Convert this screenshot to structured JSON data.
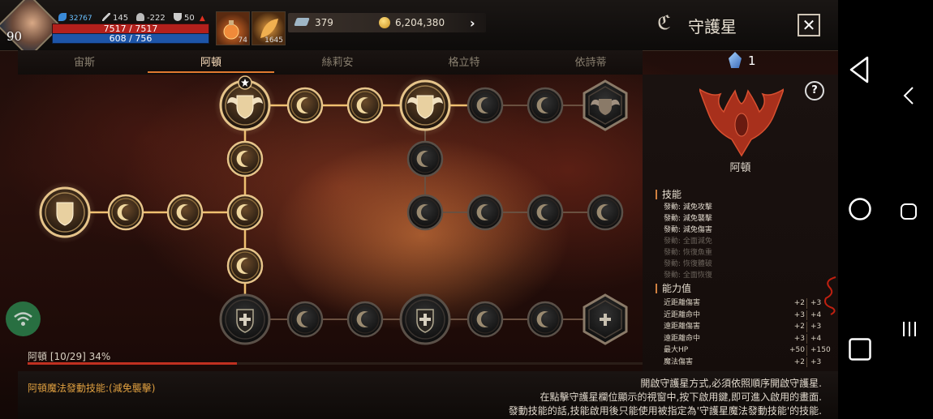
{
  "player": {
    "level": "90",
    "power": "32767",
    "attack": "145",
    "defense": "-222",
    "trophy": "50",
    "hp": "7517 / 7517",
    "mp": "608 / 756"
  },
  "items": {
    "potion_count": "74",
    "leaf_count": "1645"
  },
  "currency": {
    "gems": "379",
    "gold": "6,204,380"
  },
  "title": "守護星",
  "tabs": [
    {
      "label": "宙斯",
      "active": false
    },
    {
      "label": "阿頓",
      "active": true
    },
    {
      "label": "絲莉安",
      "active": false
    },
    {
      "label": "格立特",
      "active": false
    },
    {
      "label": "依詩蒂",
      "active": false
    }
  ],
  "crystal_count": "1",
  "panel": {
    "constellation_name": "阿頓",
    "skills_header": "技能",
    "skills": [
      {
        "name": "發動: 減免攻擊",
        "active": true
      },
      {
        "name": "發動: 減免襲擊",
        "active": true
      },
      {
        "name": "發動: 減免傷害",
        "active": true
      },
      {
        "name": "發動: 全面減免",
        "active": false
      },
      {
        "name": "發動: 恢復魚重",
        "active": false
      },
      {
        "name": "發動: 恢復體破",
        "active": false
      },
      {
        "name": "發動: 全面恢復",
        "active": false
      }
    ],
    "attributes_header": "能力值",
    "attributes": [
      {
        "name": "近距離傷害",
        "current": "+2",
        "next": "+3"
      },
      {
        "name": "近距離命中",
        "current": "+3",
        "next": "+4"
      },
      {
        "name": "遠距離傷害",
        "current": "+2",
        "next": "+3"
      },
      {
        "name": "遠距離命中",
        "current": "+3",
        "next": "+4"
      },
      {
        "name": "最大HP",
        "current": "+50",
        "next": "+150"
      },
      {
        "name": "魔法傷害",
        "current": "+2",
        "next": "+3"
      }
    ]
  },
  "progress": {
    "label": "阿頓 [10/29] 34%",
    "fraction": 0.34
  },
  "magic_skill": "阿頓魔法發動技能:(減免襲擊)",
  "info_lines": [
    "開啟守護星方式,必須依照順序開啟守護星.",
    "在點擊守護星欄位顯示的視窗中,按下啟用鍵,即可進入啟用的畫面.",
    "發動技能的話,技能啟用後只能使用被指定為'守護星魔法發動技能'的技能."
  ],
  "colors": {
    "accent": "#e07a30",
    "hp": "#b3201c",
    "mp": "#1d55a8",
    "gold": "#e0a040"
  },
  "nodes": [
    {
      "id": "start",
      "type": "shield",
      "state": "active",
      "icon": "shield-icon"
    },
    {
      "id": "l1",
      "type": "moon",
      "state": "active",
      "icon": "crescent-icon"
    },
    {
      "id": "l2",
      "type": "moon",
      "state": "active",
      "icon": "crescent-icon"
    },
    {
      "id": "junction",
      "type": "moon",
      "state": "active",
      "icon": "crescent-icon"
    },
    {
      "id": "v-up",
      "type": "moon",
      "state": "active",
      "icon": "crescent-icon"
    },
    {
      "id": "top-boss",
      "type": "winged-shield",
      "state": "active",
      "icon": "winged-shield-icon",
      "star": true
    },
    {
      "id": "t1",
      "type": "moon",
      "state": "active",
      "icon": "crescent-icon"
    },
    {
      "id": "t2",
      "type": "moon",
      "state": "active",
      "icon": "crescent-icon"
    },
    {
      "id": "top-boss-2",
      "type": "winged-shield",
      "state": "active",
      "icon": "winged-shield-icon"
    },
    {
      "id": "t3",
      "type": "moon",
      "state": "locked",
      "icon": "crescent-icon"
    },
    {
      "id": "t4",
      "type": "moon",
      "state": "locked",
      "icon": "crescent-icon"
    },
    {
      "id": "top-end",
      "type": "hex-emblem",
      "state": "locked",
      "icon": "winged-emblem-icon"
    },
    {
      "id": "m-down",
      "type": "moon",
      "state": "locked",
      "icon": "crescent-icon"
    },
    {
      "id": "m1",
      "type": "moon",
      "state": "locked",
      "icon": "crescent-icon"
    },
    {
      "id": "m2",
      "type": "moon",
      "state": "locked",
      "icon": "crescent-icon"
    },
    {
      "id": "m3",
      "type": "moon",
      "state": "locked",
      "icon": "crescent-icon"
    },
    {
      "id": "m4",
      "type": "moon",
      "state": "locked",
      "icon": "crescent-icon"
    },
    {
      "id": "v-down",
      "type": "moon",
      "state": "active",
      "icon": "crescent-icon"
    },
    {
      "id": "bottom-cross",
      "type": "cross-shield",
      "state": "locked",
      "icon": "cross-shield-icon"
    },
    {
      "id": "b1",
      "type": "moon",
      "state": "locked",
      "icon": "crescent-icon"
    },
    {
      "id": "b2",
      "type": "moon",
      "state": "locked",
      "icon": "crescent-icon"
    },
    {
      "id": "bottom-cross-2",
      "type": "cross-shield",
      "state": "locked",
      "icon": "cross-shield-icon"
    },
    {
      "id": "b3",
      "type": "moon",
      "state": "locked",
      "icon": "crescent-icon"
    },
    {
      "id": "b4",
      "type": "moon",
      "state": "locked",
      "icon": "crescent-icon"
    },
    {
      "id": "bottom-end",
      "type": "hex-emblem",
      "state": "locked",
      "icon": "cross-emblem-icon"
    }
  ]
}
